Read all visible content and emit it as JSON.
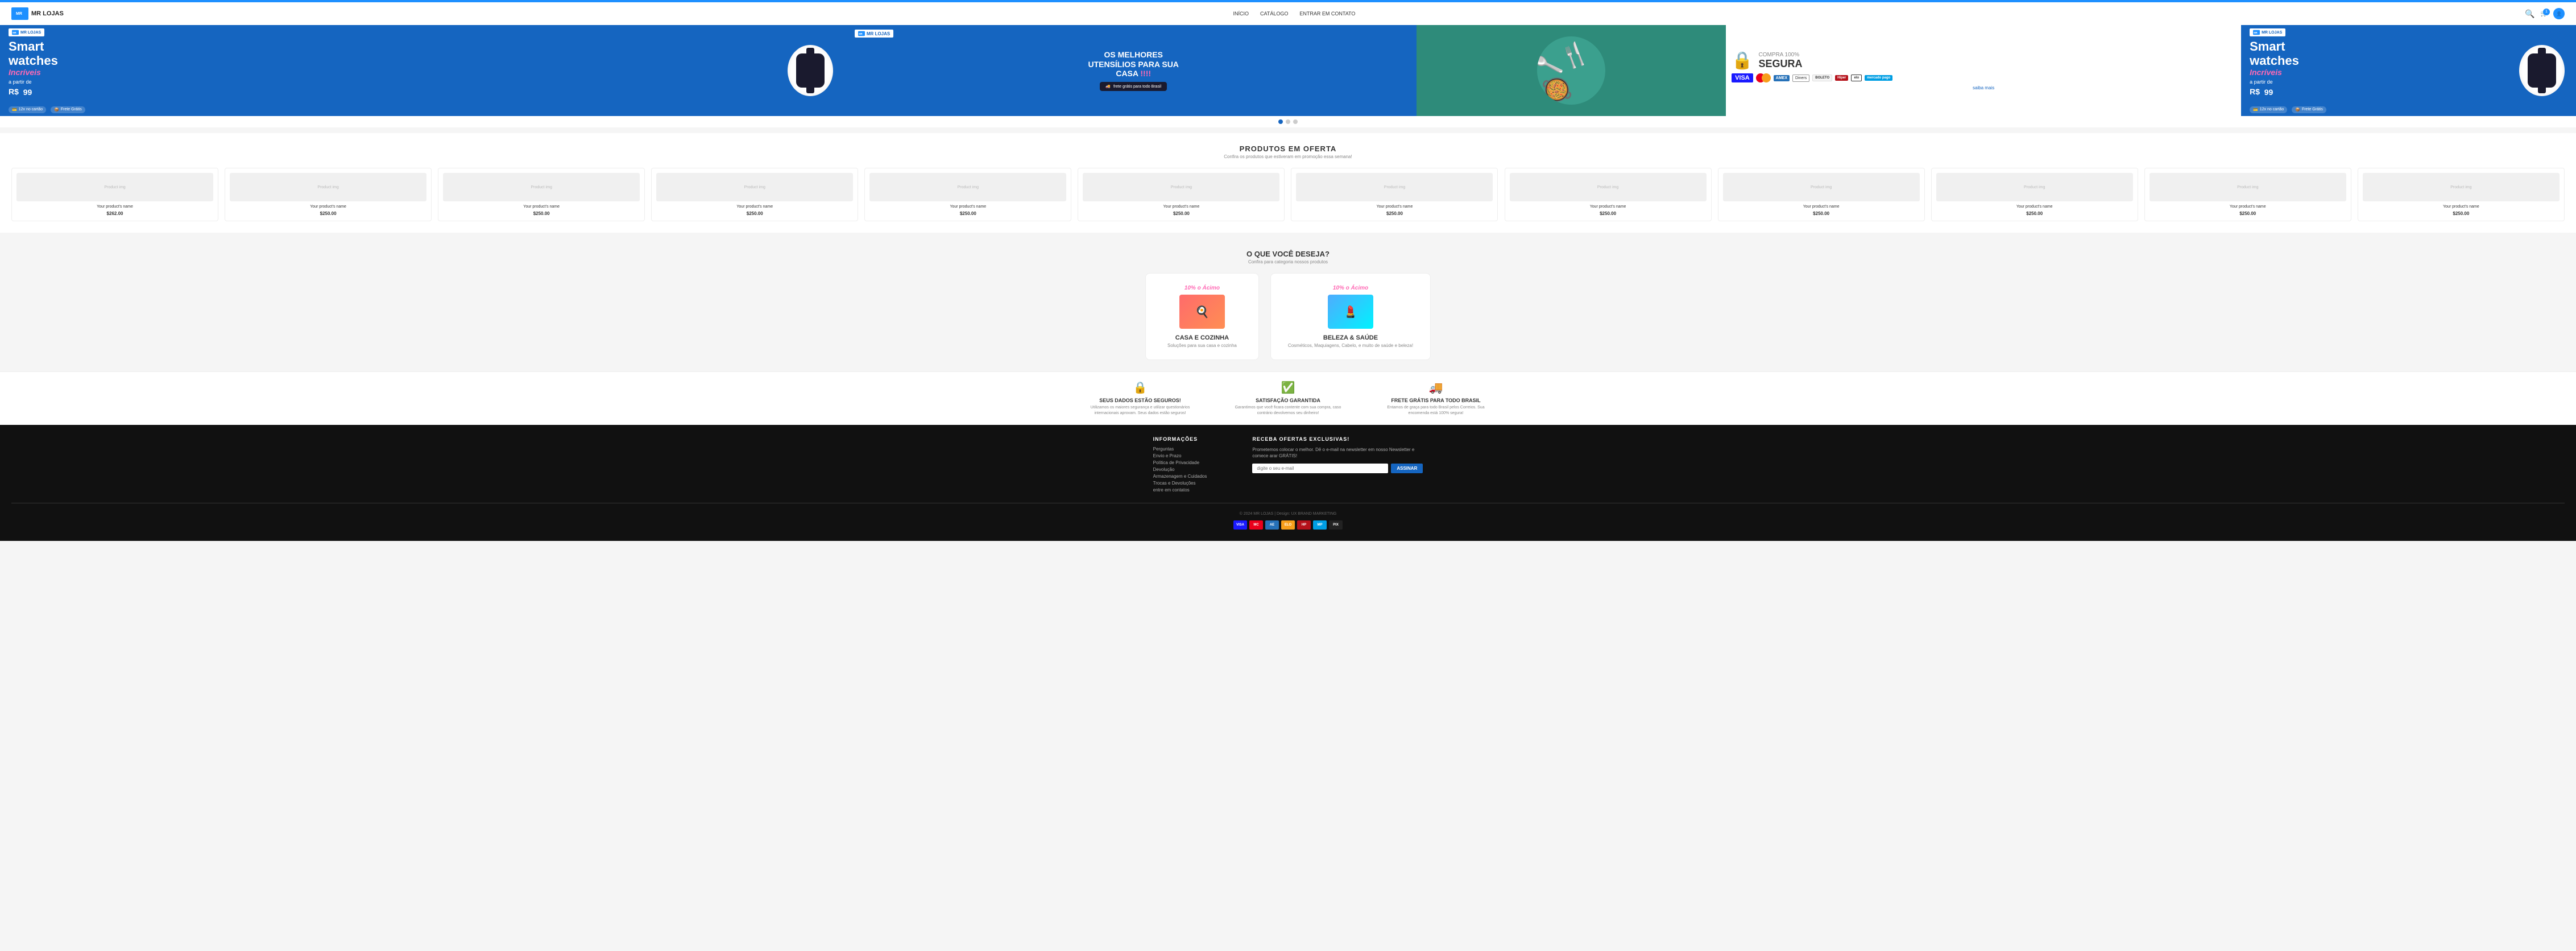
{
  "header": {
    "logo_text": "MR LOJAS",
    "logo_box": "MR",
    "nav": {
      "home": "INÍCIO",
      "catalog": "CATÁLOGO",
      "contact": "ENTRAR EM CONTATO"
    },
    "cart_count": "1"
  },
  "banners": {
    "banner1": {
      "title_line1": "Smart",
      "title_line2": "watches",
      "title_line3": "Incríveis",
      "a_partir": "a partir de",
      "currency": "R$",
      "price": "99",
      "badge1": "12x no cartão",
      "badge2": "Frete Grátis",
      "logo": "MR LOJAS"
    },
    "banner2": {
      "logo": "MR LOJAS",
      "headline1": "OS MELHORES",
      "headline2": "UTENSÍLIOS PARA SUA",
      "headline3": "CASA",
      "exclamations": "!!!!",
      "truck_label": "frete grátis para todo Brasil"
    },
    "banner4": {
      "compra": "COMPRA 100%",
      "segura": "SEGURA",
      "saiba_mais": "saiba mais"
    },
    "banner5": {
      "title_line1": "Smart",
      "title_line2": "watches",
      "title_line3": "Incríveis",
      "a_partir": "a partir de",
      "currency": "R$",
      "price": "99",
      "badge1": "12x no cartão",
      "badge2": "Frete Grátis",
      "logo": "MR LOJAS"
    }
  },
  "products_section": {
    "title": "PRODUTOS EM OFERTA",
    "subtitle": "Confira os produtos que estiveram em promoção essa semana!",
    "products": [
      {
        "img_label": "Product img",
        "name": "Your product's name",
        "price": "$262.00"
      },
      {
        "img_label": "Product img",
        "name": "Your product's name",
        "price": "$250.00"
      },
      {
        "img_label": "Product img",
        "name": "Your product's name",
        "price": "$250.00"
      },
      {
        "img_label": "Product img",
        "name": "Your product's name",
        "price": "$250.00"
      },
      {
        "img_label": "Product img",
        "name": "Your product's name",
        "price": "$250.00"
      },
      {
        "img_label": "Product img",
        "name": "Your product's name",
        "price": "$250.00"
      },
      {
        "img_label": "Product img",
        "name": "Your product's name",
        "price": "$250.00"
      },
      {
        "img_label": "Product img",
        "name": "Your product's name",
        "price": "$250.00"
      },
      {
        "img_label": "Product img",
        "name": "Your product's name",
        "price": "$250.00"
      },
      {
        "img_label": "Product img",
        "name": "Your product's name",
        "price": "$250.00"
      },
      {
        "img_label": "Product img",
        "name": "Your product's name",
        "price": "$250.00"
      },
      {
        "img_label": "Product img",
        "name": "Your product's name",
        "price": "$250.00"
      }
    ]
  },
  "deseja_section": {
    "title": "O QUE VOCÊ DESEJA?",
    "subtitle": "Confira para categoria nossos produtos",
    "categories": [
      {
        "label": "10% o Ácimo",
        "name": "CASA E COZINHA",
        "desc": "Soluções para sua casa e cozinha",
        "icon": "🍳"
      },
      {
        "label": "10% o Ácimo",
        "name": "BELEZA & SAÚDE",
        "desc": "Cosméticos, Maquiagens, Cabelo, e muito de saúde e beleza!",
        "icon": "💄"
      }
    ]
  },
  "features": [
    {
      "icon": "🔒",
      "title": "SEUS DADOS ESTÃO SEGUROS!",
      "desc": "Utilizamos os maiores segurança e utilizar questionários internacionais aprovam. Seus dados estão seguros!"
    },
    {
      "icon": "✅",
      "title": "SATISFAÇÃO GARANTIDA",
      "desc": "Garantimos que você ficara contente com sua compra, caso contrário devolvemos seu dinheiro!"
    },
    {
      "icon": "🚚",
      "title": "FRETE GRÁTIS PARA TODO BRASIL",
      "desc": "Entamos de graça para todo Brasil pelos Correios. Sua encomenda está 100% segura!"
    }
  ],
  "footer": {
    "informacoes": {
      "title": "INFORMAÇÕES",
      "links": [
        "Perguntas",
        "Envio e Prazo",
        "Política de Privacidade",
        "Devolução",
        "Armazenagem e Cuidados",
        "Trocas e Devoluções",
        "entre em contatos"
      ]
    },
    "newsletter": {
      "title": "RECEBA OFERTAS EXCLUSIVAS!",
      "text": "Prometemos colocar o melhor. Dê o e-mail na newsletter em nosso Newsletter e comece arar GRÁTIS!",
      "placeholder": "digite o seu e-mail",
      "btn_label": "ASSINAR"
    },
    "copy": "© 2024 MR LOJAS | Design: UX BRAND MARKETING",
    "payment_icons": [
      {
        "bg": "#1a1aff",
        "label": "VISA"
      },
      {
        "bg": "#eb001b",
        "label": "MC"
      },
      {
        "bg": "#2671b8",
        "label": "AE"
      },
      {
        "bg": "#f79e1b",
        "label": "ELO"
      },
      {
        "bg": "#b5121b",
        "label": "HP"
      },
      {
        "bg": "#009ee3",
        "label": "MP"
      },
      {
        "bg": "#222",
        "label": "PIX"
      }
    ]
  },
  "dots": [
    "active",
    "",
    ""
  ]
}
